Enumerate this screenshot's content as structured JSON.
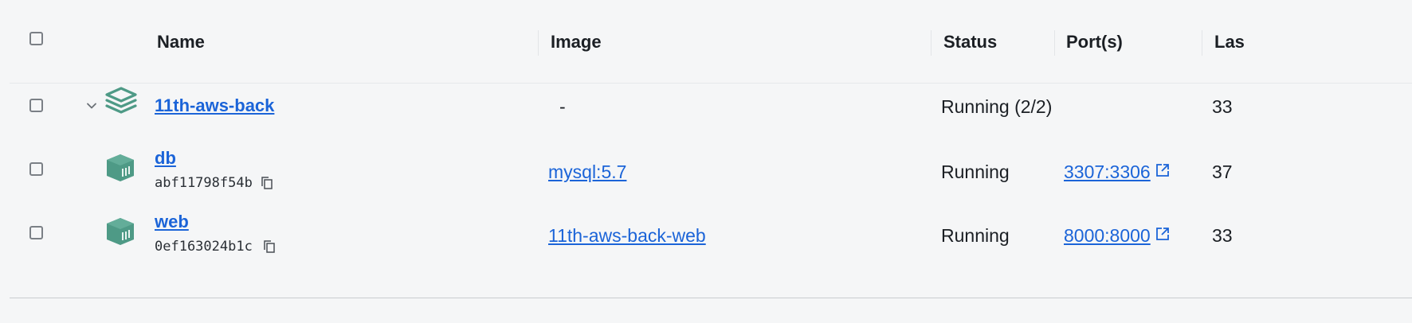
{
  "columns": {
    "name": "Name",
    "image": "Image",
    "status": "Status",
    "ports": "Port(s)",
    "last_started": "Las"
  },
  "group": {
    "name": "11th-aws-back",
    "image": "-",
    "status": "Running (2/2)",
    "last_started": "33"
  },
  "containers": [
    {
      "name": "db",
      "id": "abf11798f54b",
      "image": "mysql:5.7",
      "status": "Running",
      "port": "3307:3306",
      "last_started": "37"
    },
    {
      "name": "web",
      "id": "0ef163024b1c",
      "image": "11th-aws-back-web",
      "status": "Running",
      "port": "8000:8000",
      "last_started": "33"
    }
  ],
  "colors": {
    "link": "#1b64d8",
    "icon_green": "#4e9a86",
    "background": "#f5f6f7"
  },
  "icons": {
    "group": "stack-layers-icon",
    "container": "container-cube-icon",
    "copy": "copy-icon",
    "external": "external-link-icon",
    "expand": "chevron-down-icon"
  }
}
